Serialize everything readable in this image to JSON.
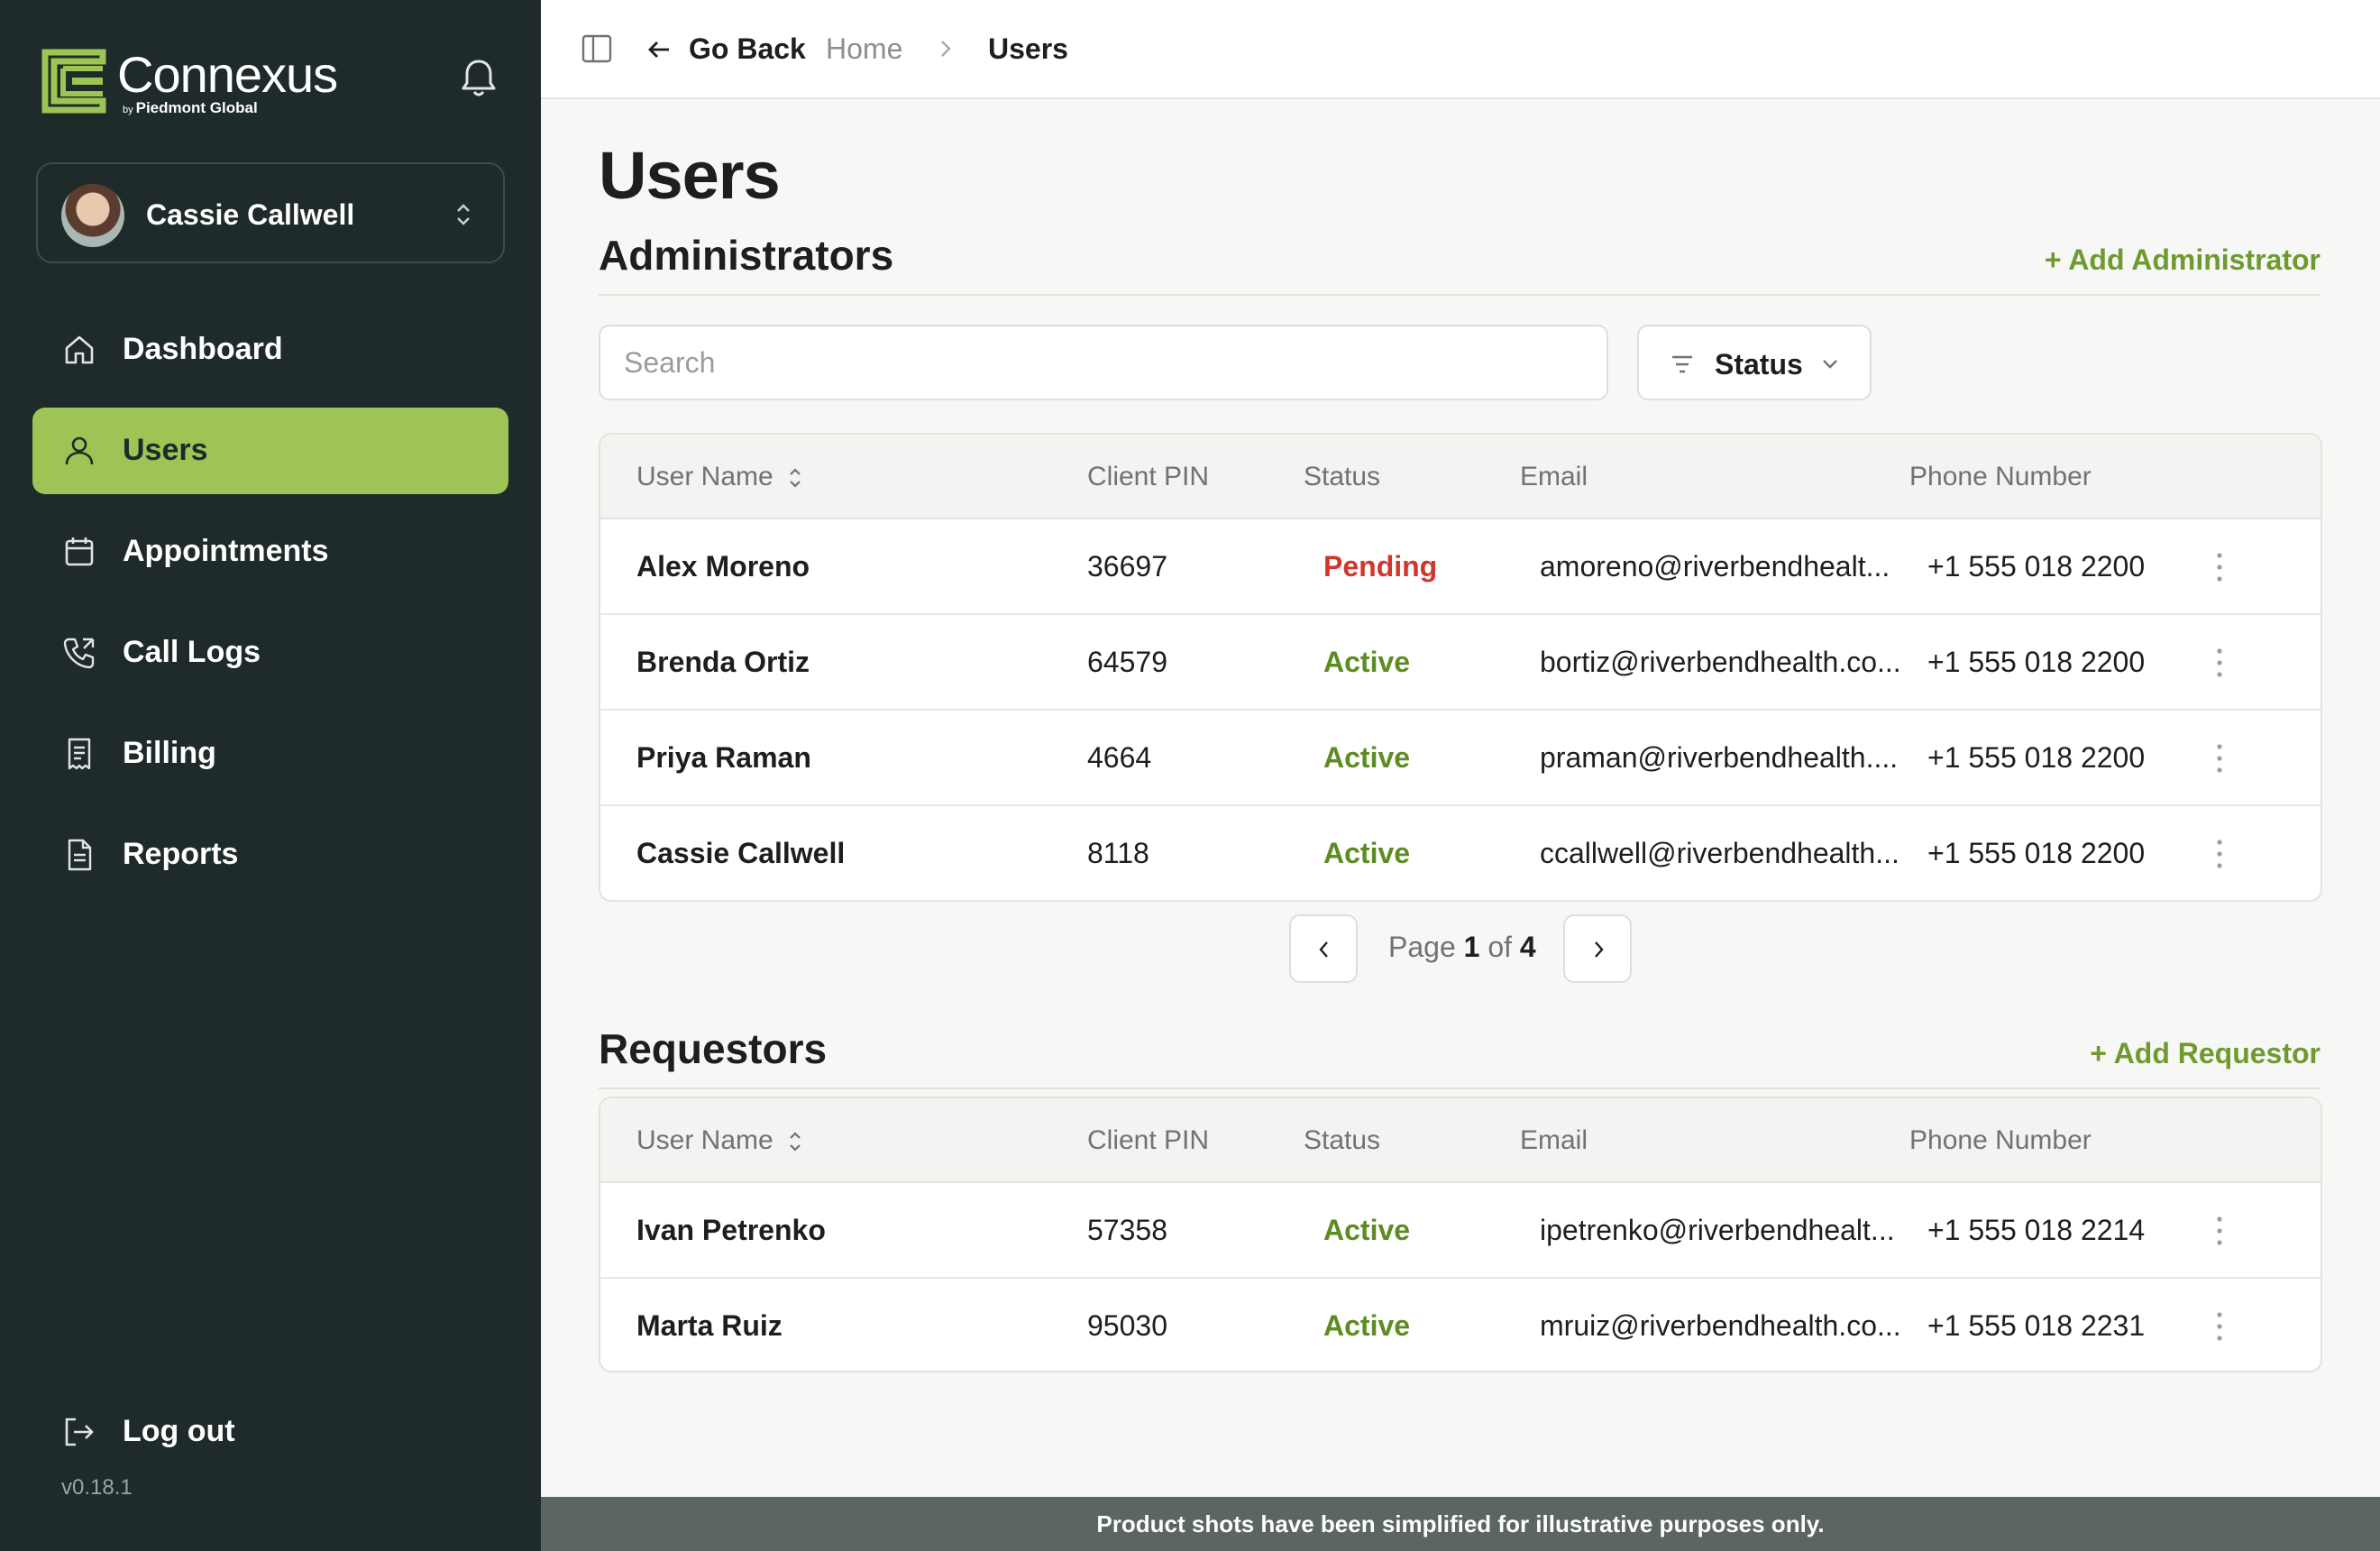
{
  "brand": {
    "name": "Connexus",
    "sub_prefix": "by",
    "sub": "Piedmont Global"
  },
  "user": {
    "name": "Cassie Callwell"
  },
  "nav": {
    "items": [
      {
        "label": "Dashboard",
        "icon": "home-icon"
      },
      {
        "label": "Users",
        "icon": "user-icon",
        "active": true
      },
      {
        "label": "Appointments",
        "icon": "calendar-icon"
      },
      {
        "label": "Call Logs",
        "icon": "phone-icon"
      },
      {
        "label": "Billing",
        "icon": "receipt-icon"
      },
      {
        "label": "Reports",
        "icon": "document-icon"
      }
    ],
    "logout": "Log out",
    "version": "v0.18.1"
  },
  "topbar": {
    "go_back": "Go Back",
    "breadcrumb": [
      "Home",
      "Users"
    ]
  },
  "page": {
    "title": "Users"
  },
  "administrators": {
    "title": "Administrators",
    "add_label": "+ Add Administrator",
    "search_placeholder": "Search",
    "status_filter": "Status",
    "columns": [
      "User Name",
      "Client PIN",
      "Status",
      "Email",
      "Phone Number"
    ],
    "rows": [
      {
        "name": "Alex Moreno",
        "pin": "36697",
        "status": "Pending",
        "email": "amoreno@riverbendhealt...",
        "phone": "+1 555 018 2200"
      },
      {
        "name": "Brenda Ortiz",
        "pin": "64579",
        "status": "Active",
        "email": "bortiz@riverbendhealth.co...",
        "phone": "+1 555 018 2200"
      },
      {
        "name": "Priya Raman",
        "pin": "4664",
        "status": "Active",
        "email": "praman@riverbendhealth....",
        "phone": "+1 555 018 2200"
      },
      {
        "name": "Cassie Callwell",
        "pin": "8118",
        "status": "Active",
        "email": "ccallwell@riverbendhealth...",
        "phone": "+1 555 018 2200"
      }
    ],
    "pager": {
      "prefix": "Page",
      "current": "1",
      "of": "of",
      "total": "4"
    }
  },
  "requestors": {
    "title": "Requestors",
    "add_label": "+ Add Requestor",
    "columns": [
      "User Name",
      "Client PIN",
      "Status",
      "Email",
      "Phone Number"
    ],
    "rows": [
      {
        "name": "Ivan Petrenko",
        "pin": "57358",
        "status": "Active",
        "email": "ipetrenko@riverbendhealt...",
        "phone": "+1 555 018 2214"
      },
      {
        "name": "Marta Ruiz",
        "pin": "95030",
        "status": "Active",
        "email": "mruiz@riverbendhealth.co...",
        "phone": "+1 555 018 2231"
      }
    ]
  },
  "footer": {
    "text": "Product shots have been simplified for illustrative purposes only."
  },
  "colors": {
    "sidebar": "#1e2b2a",
    "accent": "#9dc454",
    "link": "#6e9a2f",
    "active_status": "#5d8c22",
    "pending_status": "#d0362c"
  }
}
